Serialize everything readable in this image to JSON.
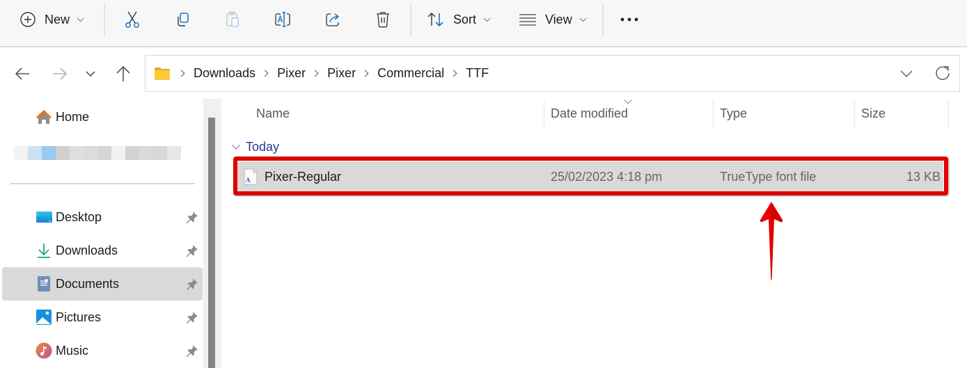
{
  "toolbar": {
    "new_label": "New",
    "sort_label": "Sort",
    "view_label": "View",
    "icons": [
      "plus-circle-icon",
      "cut-icon",
      "copy-icon",
      "paste-icon",
      "rename-icon",
      "share-icon",
      "delete-icon",
      "sort-icon",
      "view-icon",
      "more-icon"
    ]
  },
  "navigation": {
    "back": "back-arrow-icon",
    "forward": "forward-arrow-icon",
    "recent": "chevron-down-icon",
    "up": "up-arrow-icon"
  },
  "address_bar": {
    "breadcrumbs": [
      "Downloads",
      "Pixer",
      "Pixer",
      "Commercial",
      "TTF"
    ]
  },
  "sidebar": {
    "home_label": "Home",
    "items": [
      {
        "label": "Desktop",
        "icon": "desktop-icon",
        "pinned": true,
        "selected": false
      },
      {
        "label": "Downloads",
        "icon": "download-icon",
        "pinned": true,
        "selected": false
      },
      {
        "label": "Documents",
        "icon": "documents-icon",
        "pinned": true,
        "selected": true
      },
      {
        "label": "Pictures",
        "icon": "pictures-icon",
        "pinned": true,
        "selected": false
      },
      {
        "label": "Music",
        "icon": "music-icon",
        "pinned": true,
        "selected": false
      }
    ]
  },
  "file_list": {
    "columns": [
      "Name",
      "Date modified",
      "Type",
      "Size"
    ],
    "sorted_by": "Date modified",
    "groups": [
      {
        "label": "Today",
        "files": [
          {
            "name": "Pixer-Regular",
            "date_modified": "25/02/2023 4:18 pm",
            "type": "TrueType font file",
            "size": "13 KB",
            "selected": true
          }
        ]
      }
    ]
  },
  "annotation": {
    "highlight_color": "#e00000",
    "arrow_color": "#e00000"
  }
}
